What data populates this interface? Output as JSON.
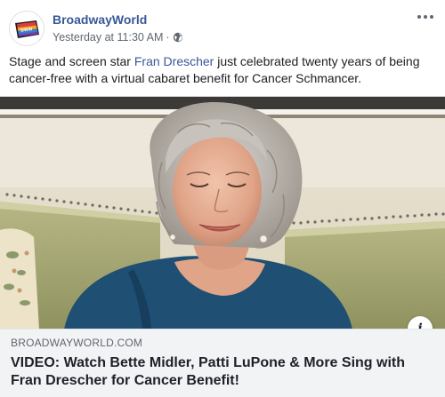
{
  "post": {
    "author": "BroadwayWorld",
    "timestamp": "Yesterday at 11:30 AM",
    "separator": "·",
    "privacy_icon": "globe-icon",
    "more_icon": "more-horizontal-icon",
    "text_before": "Stage and screen star ",
    "mention": "Fran Drescher",
    "text_after": " just celebrated twenty years of being cancer-free with a virtual cabaret benefit for Cancer Schmancer.",
    "link": {
      "domain": "BROADWAYWORLD.COM",
      "title": "VIDEO: Watch Bette Midler, Patti LuPone & More Sing with Fran Drescher for Cancer Benefit!",
      "info_label": "i"
    }
  },
  "colors": {
    "link_blue": "#385898",
    "meta_gray": "#606770",
    "caption_bg": "#f2f3f5"
  }
}
